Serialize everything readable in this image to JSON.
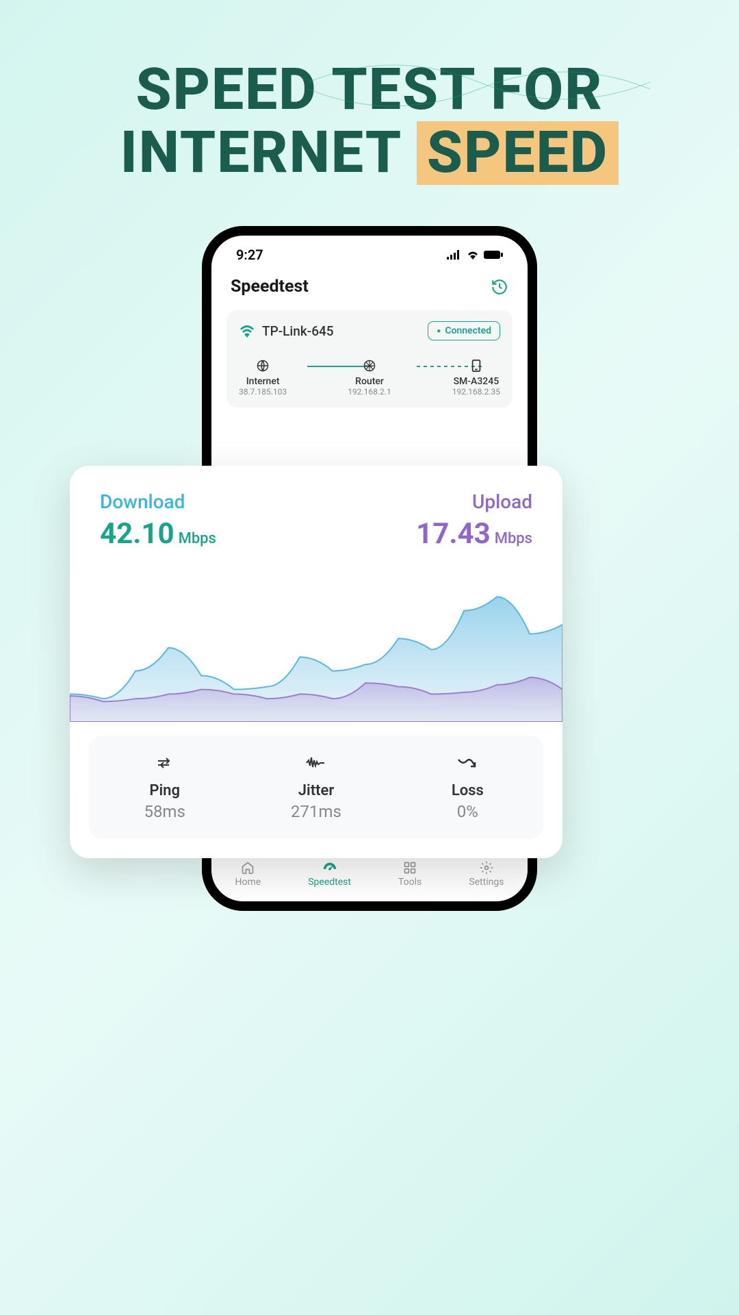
{
  "hero": {
    "line1": "SPEED TEST FOR",
    "line2_prefix": "INTERNET ",
    "line2_highlight": "SPEED"
  },
  "status": {
    "time": "9:27"
  },
  "header": {
    "title": "Speedtest"
  },
  "connection": {
    "network_name": "TP-Link-645",
    "status_label": "Connected",
    "nodes": [
      {
        "label": "Internet",
        "ip": "38.7.185.103"
      },
      {
        "label": "Router",
        "ip": "192.168.2.1"
      },
      {
        "label": "SM-A3245",
        "ip": "192.168.2.35"
      }
    ]
  },
  "speed": {
    "download_label": "Download",
    "download_value": "42.10",
    "download_unit": "Mbps",
    "upload_label": "Upload",
    "upload_value": "17.43",
    "upload_unit": "Mbps"
  },
  "metrics": [
    {
      "label": "Ping",
      "value": "58ms"
    },
    {
      "label": "Jitter",
      "value": "271ms"
    },
    {
      "label": "Loss",
      "value": "0%"
    }
  ],
  "nav": [
    {
      "label": "Home"
    },
    {
      "label": "Speedtest"
    },
    {
      "label": "Tools"
    },
    {
      "label": "Settings"
    }
  ],
  "chart_data": {
    "type": "area",
    "series": [
      {
        "name": "Download",
        "values": [
          30,
          25,
          55,
          80,
          50,
          35,
          38,
          70,
          55,
          62,
          90,
          78,
          120,
          135,
          95,
          105
        ]
      },
      {
        "name": "Upload",
        "values": [
          28,
          22,
          25,
          30,
          35,
          30,
          25,
          30,
          25,
          42,
          38,
          30,
          32,
          40,
          48,
          35
        ]
      }
    ],
    "title": "",
    "xlabel": "",
    "ylabel": "",
    "ylim": [
      0,
      170
    ]
  }
}
